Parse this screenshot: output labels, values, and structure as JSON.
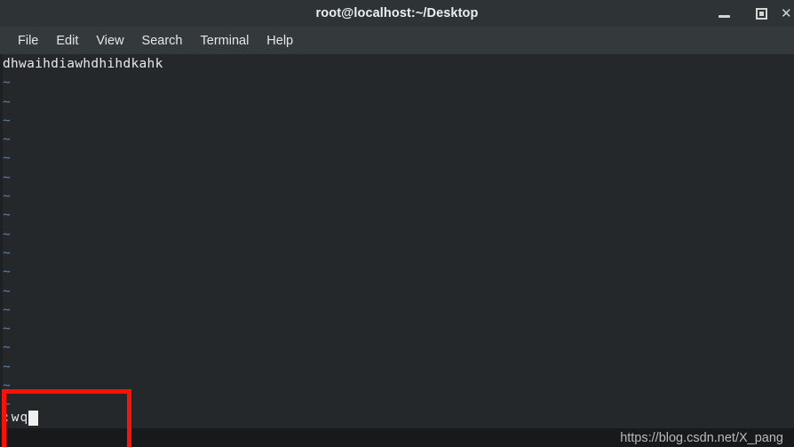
{
  "window": {
    "title": "root@localhost:~/Desktop",
    "controls": [
      {
        "name": "minimize",
        "glyph": "—"
      },
      {
        "name": "maximize",
        "glyph": "▣"
      },
      {
        "name": "close",
        "glyph": "✕"
      }
    ]
  },
  "menubar": {
    "items": [
      {
        "label": "File"
      },
      {
        "label": "Edit"
      },
      {
        "label": "View"
      },
      {
        "label": "Search"
      },
      {
        "label": "Terminal"
      },
      {
        "label": "Help"
      }
    ]
  },
  "terminal": {
    "editor": "vim",
    "first_line": "dhwaihdiawhdhihdkahk",
    "empty_line_marker": "~",
    "empty_line_count": 18,
    "status_line": {
      "command": ":wq",
      "cursor": "block"
    },
    "colors": {
      "background": "#24282b",
      "text": "#e8eaea",
      "tilde": "#5f7fa8",
      "cursor": "#f0f0f0"
    }
  },
  "annotation": {
    "shape": "rectangle",
    "color": "#fc1205",
    "target": ":wq"
  },
  "watermark": {
    "text": "https://blog.csdn.net/X_pang"
  }
}
